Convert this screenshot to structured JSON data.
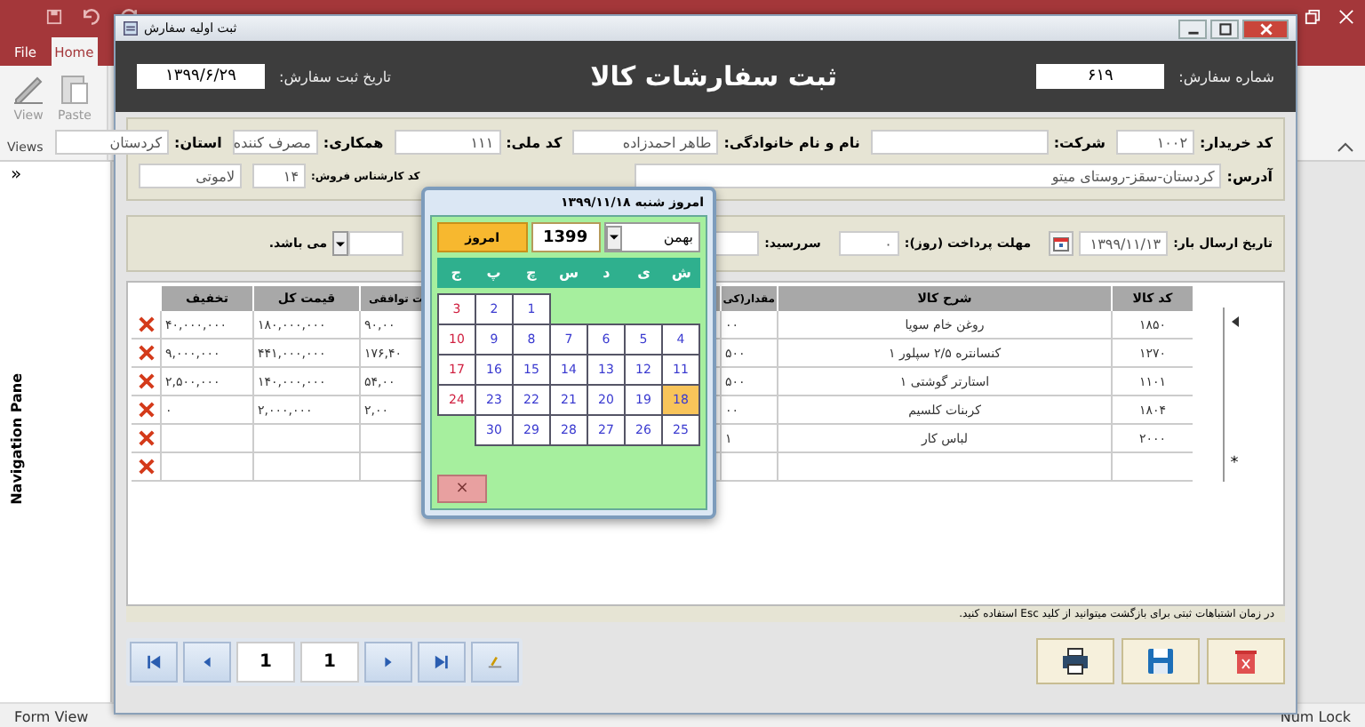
{
  "app": {
    "file_tab": {
      "label": "File",
      "selected": false
    },
    "home_tab": {
      "label": "Home",
      "selected": true
    },
    "view_button": {
      "label": "View"
    },
    "paste_button": {
      "label": "Paste"
    },
    "group_label": "Views",
    "nav_pane": {
      "toggle": "»",
      "title": "Navigation Pane"
    }
  },
  "form": {
    "title": "ثبت اولیه سفارش",
    "heading": "ثبت سفارشات کالا",
    "order_number": {
      "label": "شماره سفارش:",
      "value": "۶۱۹"
    },
    "order_date": {
      "label": "تاریخ ثبت سفارش:",
      "value": "۱۳۹۹/۶/۲۹"
    },
    "customer_rows": [
      [
        {
          "label": "کد خریدار:",
          "value": "۱۰۰۲"
        },
        {
          "label": "شرکت:"
        },
        {
          "label": "نام و نام خانوادگی:",
          "value": "طاهر احمدزاده"
        },
        {
          "label": "کد ملی:",
          "value": "۱۱۱"
        },
        {
          "label": "همکاری:",
          "value": "مصرف کننده"
        },
        {
          "label": "استان:",
          "value": "کردستان"
        }
      ],
      [
        {
          "label": "آدرس:",
          "value": "کردستان-سقز-روستای میتو"
        },
        {
          "label": "کد کارشناس فروش:",
          "value": "۱۴"
        },
        {
          "value": "لاموتی"
        }
      ]
    ],
    "shipping": [
      {
        "kind": "date",
        "label": "تاریخ ارسال بار:",
        "value": "۱۳۹۹/۱۱/۱۳"
      },
      {
        "kind": "text",
        "label": "مهلت پرداخت (روز):",
        "value": "۰"
      },
      {
        "kind": "text",
        "label": "سررسید:"
      },
      {
        "kind": "dropdown"
      },
      {
        "kind": "note",
        "label": "می باشد."
      }
    ],
    "table": {
      "columns": [
        "کد کالا",
        "شرح کالا",
        "مقدار(کی",
        "ت توافقی",
        "قیمت کل",
        "تخفیف"
      ],
      "new_row_marker": "*",
      "rows": [
        {
          "current": true,
          "new_record": false,
          "cells": [
            "۱۸۵۰",
            "روغن خام سویا",
            "۰۰",
            "۹۰,۰۰",
            "۱۸۰,۰۰۰,۰۰۰",
            "۴۰,۰۰۰,۰۰۰"
          ]
        },
        {
          "current": false,
          "new_record": false,
          "cells": [
            "۱۲۷۰",
            "کنسانتره ۲/۵ سپلور ۱",
            "۵۰۰",
            "۱۷۶,۴۰",
            "۴۴۱,۰۰۰,۰۰۰",
            "۹,۰۰۰,۰۰۰"
          ]
        },
        {
          "current": false,
          "new_record": false,
          "cells": [
            "۱۱۰۱",
            "استارتر گوشتی ۱",
            "۵۰۰",
            "۵۴,۰۰",
            "۱۴۰,۰۰۰,۰۰۰",
            "۲,۵۰۰,۰۰۰"
          ]
        },
        {
          "current": false,
          "new_record": false,
          "cells": [
            "۱۸۰۴",
            "کربنات کلسیم",
            "۰۰",
            "۲,۰۰",
            "۲,۰۰۰,۰۰۰",
            "۰"
          ]
        },
        {
          "current": false,
          "new_record": false,
          "cells": [
            "۲۰۰۰",
            "لباس کار",
            "۱",
            null,
            null,
            null
          ]
        },
        {
          "current": false,
          "new_record": true,
          "cells": []
        }
      ]
    },
    "hint": "در زمان اشتباهات ثبتی برای بازگشت میتوانید از کلید Esc استفاده کنید.",
    "record_nav": {
      "current": "1",
      "total": "1"
    },
    "calendar": {
      "title": "امروز شنبه ۱۳۹۹/۱۱/۱۸",
      "month": "بهمن",
      "year": "1399",
      "today_button": "امروز",
      "weekdays": [
        "ش",
        "ی",
        "د",
        "س",
        "چ",
        "پ",
        "ج"
      ],
      "weeks": [
        [
          {
            "day": "1",
            "selected": false
          },
          {
            "day": "2",
            "selected": false
          },
          {
            "day": "3",
            "selected": false
          }
        ],
        [
          {
            "day": "4",
            "selected": false
          },
          {
            "day": "5",
            "selected": false
          },
          {
            "day": "6",
            "selected": false
          },
          {
            "day": "7",
            "selected": false
          },
          {
            "day": "8",
            "selected": false
          },
          {
            "day": "9",
            "selected": false
          },
          {
            "day": "10",
            "selected": false
          }
        ],
        [
          {
            "day": "11",
            "selected": false
          },
          {
            "day": "12",
            "selected": false
          },
          {
            "day": "13",
            "selected": false
          },
          {
            "day": "14",
            "selected": false
          },
          {
            "day": "15",
            "selected": false
          },
          {
            "day": "16",
            "selected": false
          },
          {
            "day": "17",
            "selected": false
          }
        ],
        [
          {
            "day": "18",
            "selected": true
          },
          {
            "day": "19",
            "selected": false
          },
          {
            "day": "20",
            "selected": false
          },
          {
            "day": "21",
            "selected": false
          },
          {
            "day": "22",
            "selected": false
          },
          {
            "day": "23",
            "selected": false
          },
          {
            "day": "24",
            "selected": false
          }
        ],
        [
          {
            "day": "25",
            "selected": false
          },
          {
            "day": "26",
            "selected": false
          },
          {
            "day": "27",
            "selected": false
          },
          {
            "day": "28",
            "selected": false
          },
          {
            "day": "29",
            "selected": false
          },
          {
            "day": "30",
            "selected": false
          }
        ]
      ],
      "close": "×"
    }
  },
  "status_bar": {
    "left": "Form View",
    "right": "Num Lock"
  }
}
